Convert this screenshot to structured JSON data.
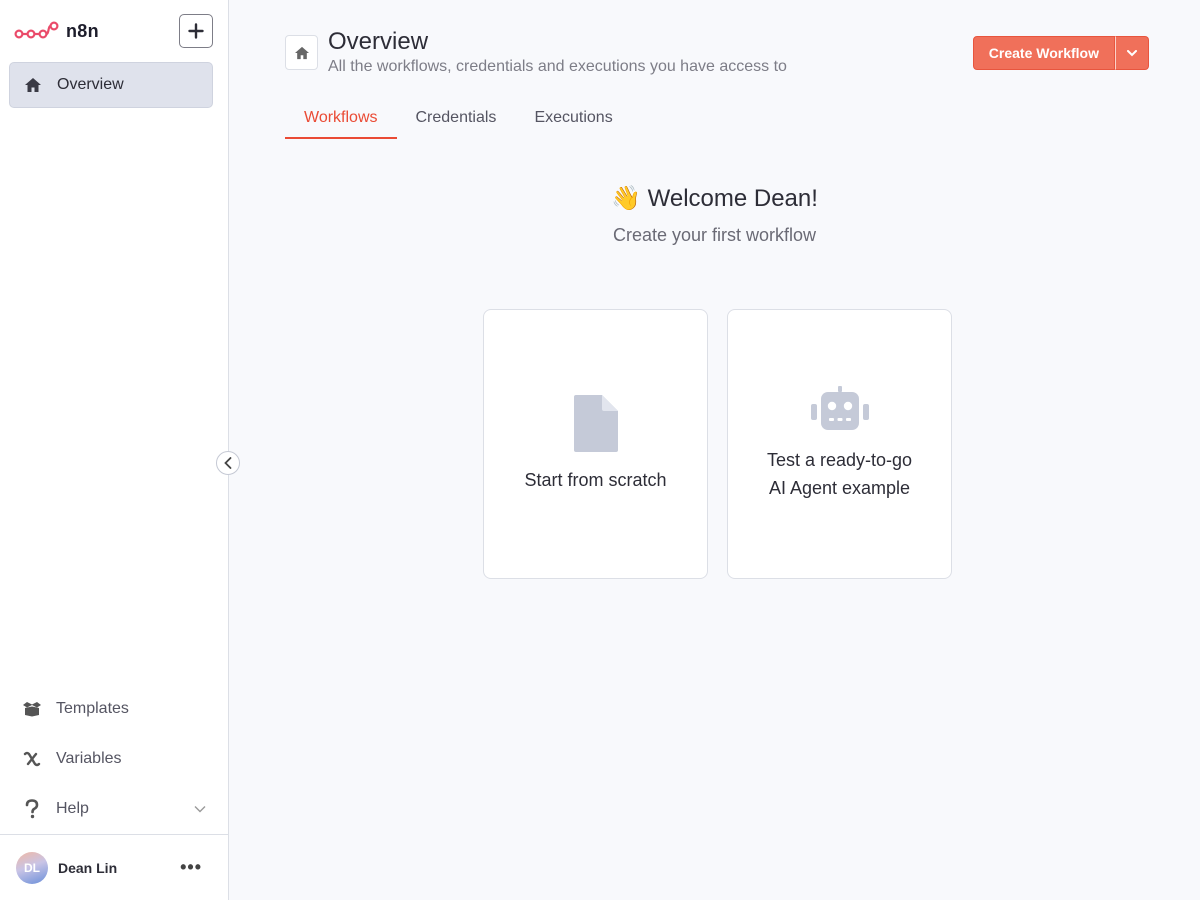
{
  "app": {
    "name": "n8n",
    "brand_color": "#ea4b35"
  },
  "sidebar": {
    "items": [
      {
        "label": "Overview",
        "icon": "home-icon",
        "active": true
      }
    ],
    "bottom_items": [
      {
        "label": "Templates",
        "icon": "box-open-icon"
      },
      {
        "label": "Variables",
        "icon": "variable-icon"
      },
      {
        "label": "Help",
        "icon": "question-icon"
      }
    ],
    "user": {
      "initials": "DL",
      "name": "Dean Lin",
      "more": "•••"
    }
  },
  "header": {
    "title": "Overview",
    "subtitle": "All the workflows, credentials and executions you have access to",
    "create_label": "Create Workflow"
  },
  "tabs": [
    {
      "label": "Workflows",
      "active": true
    },
    {
      "label": "Credentials",
      "active": false
    },
    {
      "label": "Executions",
      "active": false
    }
  ],
  "welcome": {
    "emoji": "👋",
    "title": "Welcome Dean!",
    "subtitle": "Create your first workflow"
  },
  "cards": [
    {
      "label": "Start from scratch",
      "icon": "file-icon"
    },
    {
      "label": "Test a ready-to-go\nAI Agent example",
      "icon": "robot-icon"
    }
  ]
}
